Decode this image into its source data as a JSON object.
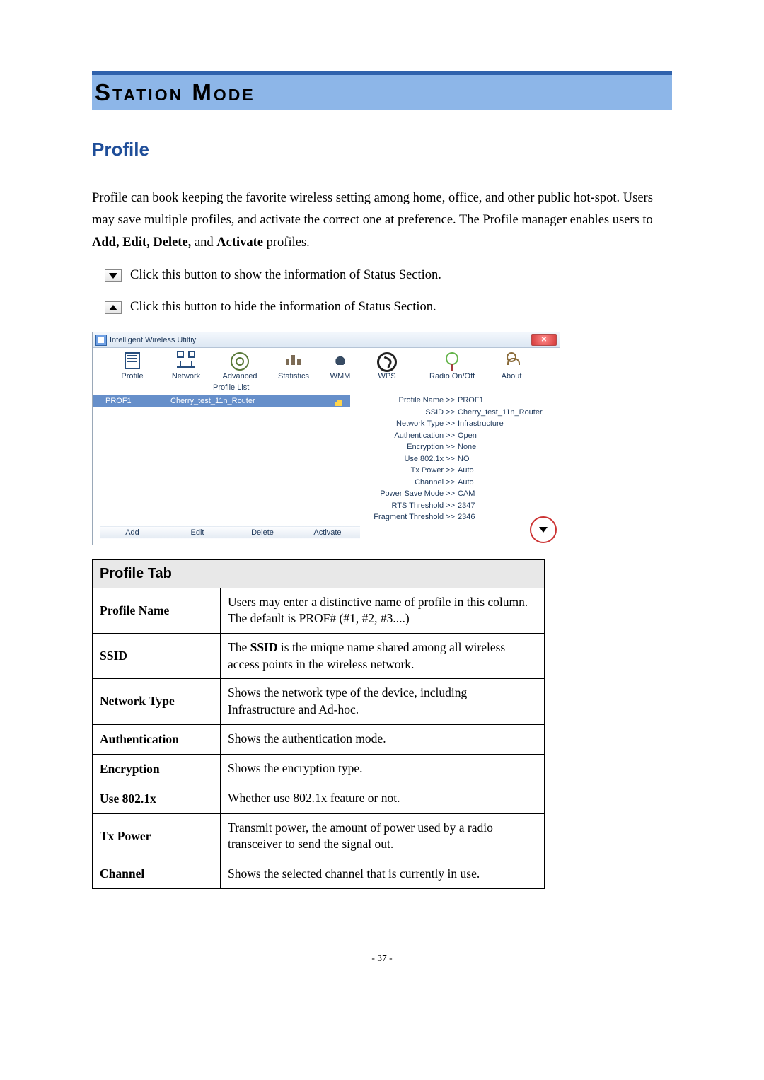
{
  "page": {
    "section_banner": "Station Mode",
    "section_title": "Profile",
    "intro_part1": "Profile can book keeping the favorite wireless setting among home, office, and other public hot-spot. Users may save multiple profiles, and activate the correct one at preference. The Profile manager enables users to ",
    "intro_bold": "Add, Edit, Delete,",
    "intro_part2": " and ",
    "intro_bold2": "Activate",
    "intro_part3": " profiles.",
    "btn_down_text": "Click this button to show the information of Status Section.",
    "btn_up_text": "Click this button to hide the information of Status Section.",
    "page_number": "- 37 -"
  },
  "app": {
    "title": "Intelligent Wireless Utiltiy",
    "close_glyph": "✕",
    "toolbar": [
      {
        "label": "Profile",
        "icon": "profile-icon"
      },
      {
        "label": "Network",
        "icon": "network-icon"
      },
      {
        "label": "Advanced",
        "icon": "advanced-icon"
      },
      {
        "label": "Statistics",
        "icon": "statistics-icon"
      },
      {
        "label": "WMM",
        "icon": "wmm-icon"
      },
      {
        "label": "WPS",
        "icon": "wps-icon"
      },
      {
        "label": "Radio On/Off",
        "icon": "radio-icon"
      },
      {
        "label": "About",
        "icon": "about-icon"
      }
    ],
    "list_label": "Profile List",
    "selected_row": {
      "name": "PROF1",
      "ssid": "Cherry_test_11n_Router"
    },
    "details": [
      {
        "k": "Profile Name >>",
        "v": "PROF1"
      },
      {
        "k": "SSID >>",
        "v": "Cherry_test_11n_Router"
      },
      {
        "k": "Network Type >>",
        "v": "Infrastructure"
      },
      {
        "k": "Authentication >>",
        "v": "Open"
      },
      {
        "k": "Encryption >>",
        "v": "None"
      },
      {
        "k": "Use 802.1x >>",
        "v": "NO"
      },
      {
        "k": "Tx Power >>",
        "v": "Auto"
      },
      {
        "k": "Channel >>",
        "v": "Auto"
      },
      {
        "k": "Power Save Mode >>",
        "v": "CAM"
      },
      {
        "k": "RTS Threshold >>",
        "v": "2347"
      },
      {
        "k": "Fragment Threshold >>",
        "v": "2346"
      }
    ],
    "actions": [
      "Add",
      "Edit",
      "Delete",
      "Activate"
    ]
  },
  "table": {
    "header": "Profile Tab",
    "rows": [
      {
        "k": "Profile Name",
        "v": "Users may enter a distinctive name of profile in this column. The default is PROF# (#1, #2, #3....)"
      },
      {
        "k": "SSID",
        "v_pre": "The ",
        "v_bold": "SSID",
        "v_post": " is the unique name shared among all wireless access points in the wireless network."
      },
      {
        "k": "Network Type",
        "v": "Shows the network type of the device, including Infrastructure and Ad-hoc."
      },
      {
        "k": "Authentication",
        "v": "Shows the authentication mode."
      },
      {
        "k": "Encryption",
        "v": "Shows the encryption type."
      },
      {
        "k": "Use 802.1x",
        "v": "Whether use 802.1x feature or not."
      },
      {
        "k": "Tx Power",
        "v": "Transmit power, the amount of power used by a radio transceiver to send the signal out."
      },
      {
        "k": "Channel",
        "v": "Shows the selected channel that is currently in use."
      }
    ]
  }
}
